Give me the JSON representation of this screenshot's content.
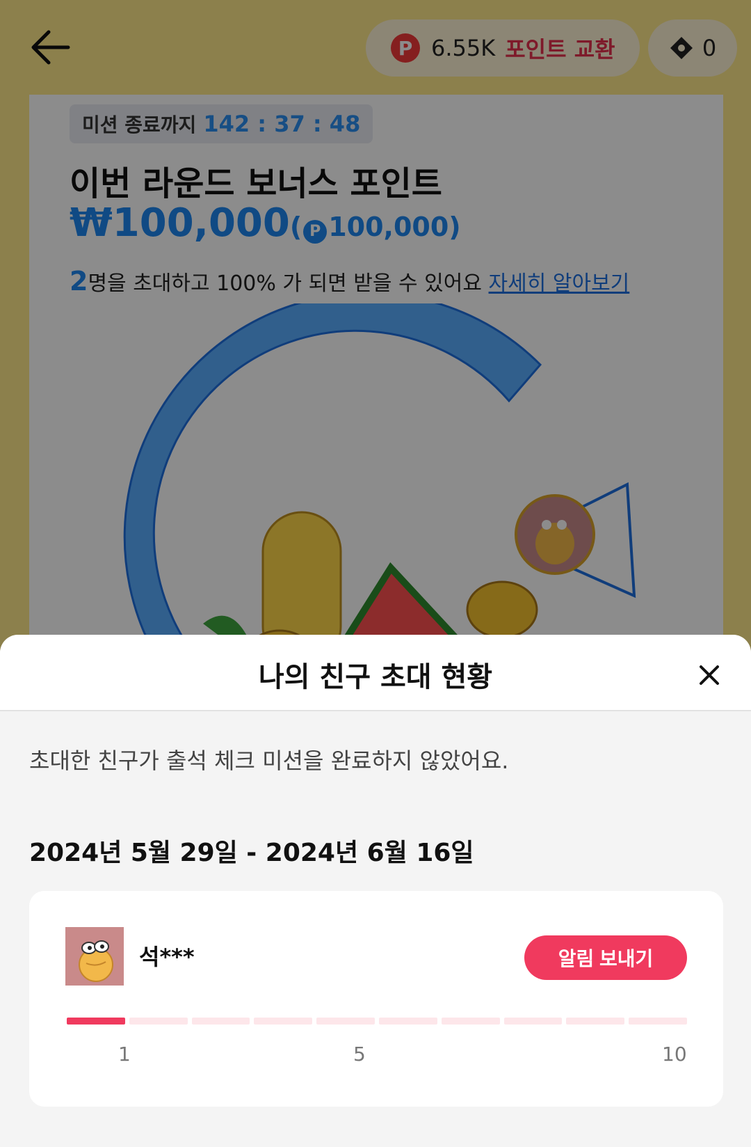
{
  "header": {
    "points_value": "6.55K",
    "points_exchange_label": "포인트 교환",
    "point_coin_glyph": "P",
    "ticket_count": "0"
  },
  "mission": {
    "timer_label": "미션 종료까지",
    "timer_value": "142 : 37 : 48",
    "round_title": "이번 라운드 보너스 포인트",
    "bonus_won": "₩100,000",
    "bonus_paren_open": "(",
    "bonus_points": "100,000",
    "bonus_paren_close": ")",
    "invite_count": "2",
    "invite_text": "명을 초대하고 100% 가 되면 받을 수 있어요",
    "learn_more_link": "자세히 알아보기",
    "progress_ring_fraction": 0.75
  },
  "sheet": {
    "title": "나의 친구 초대 현황",
    "message": "초대한 친구가 출석 체크 미션을 완료하지 않았어요.",
    "period": "2024년 5월 29일 - 2024년 6월 16일",
    "friends": [
      {
        "name": "석***",
        "notify_label": "알림 보내기",
        "progress_done": 1,
        "progress_total": 10
      }
    ],
    "ticks": [
      "1",
      "5",
      "10"
    ]
  },
  "colors": {
    "accent_blue": "#1e88f0",
    "accent_red": "#f03a5e",
    "background_yellow": "#ffe98a"
  }
}
